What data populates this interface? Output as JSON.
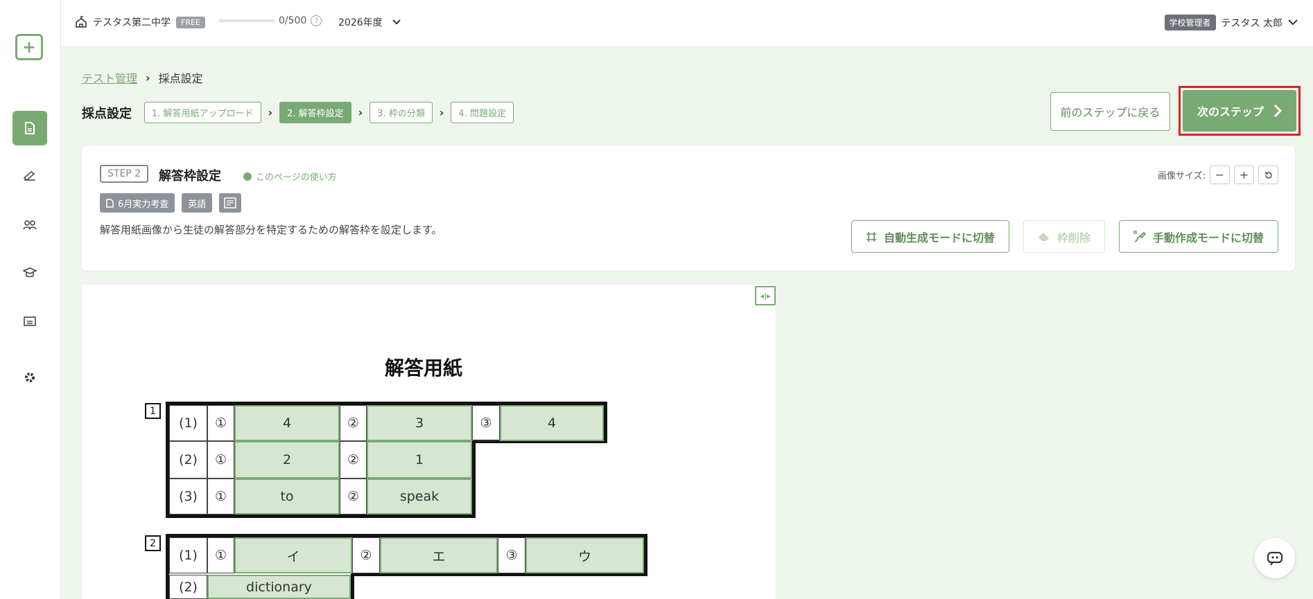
{
  "topbar": {
    "school": "テスタス第二中学",
    "plan": "FREE",
    "quota": "0/500",
    "help": "?",
    "year": "2026年度",
    "role": "学校管理者",
    "user": "テスタス 太郎"
  },
  "breadcrumb": {
    "parent": "テスト管理",
    "current": "採点設定"
  },
  "steps": {
    "title": "採点設定",
    "items": [
      "1. 解答用紙アップロード",
      "2. 解答枠設定",
      "3. 枠の分類",
      "4. 問題設定"
    ],
    "prev": "前のステップに戻る",
    "next": "次のステップ"
  },
  "card": {
    "step_badge": "STEP 2",
    "title": "解答枠設定",
    "howto": "このページの使い方",
    "tags": [
      "6月実力考査",
      "英語"
    ],
    "description": "解答用紙画像から生徒の解答部分を特定するための解答枠を設定します。",
    "image_size_label": "画像サイズ:",
    "auto_mode": "自動生成モードに切替",
    "delete_frame": "枠削除",
    "manual_mode": "手動作成モードに切替"
  },
  "sheet": {
    "title": "解答用紙",
    "q1": {
      "num": "1",
      "rows": [
        {
          "label": "(1)",
          "answers": [
            "4",
            "3",
            "4"
          ]
        },
        {
          "label": "(2)",
          "answers": [
            "2",
            "1"
          ]
        },
        {
          "label": "(3)",
          "answers": [
            "to",
            "speak"
          ]
        }
      ]
    },
    "q2": {
      "num": "2",
      "rows": [
        {
          "label": "(1)",
          "answers": [
            "イ",
            "エ",
            "ウ"
          ]
        },
        {
          "label": "(2)",
          "answers": [
            "dictionary"
          ]
        }
      ]
    },
    "circle_nums": [
      "①",
      "②",
      "③"
    ]
  },
  "colors": {
    "accent": "#7aaa73",
    "highlight": "#dd2222"
  }
}
